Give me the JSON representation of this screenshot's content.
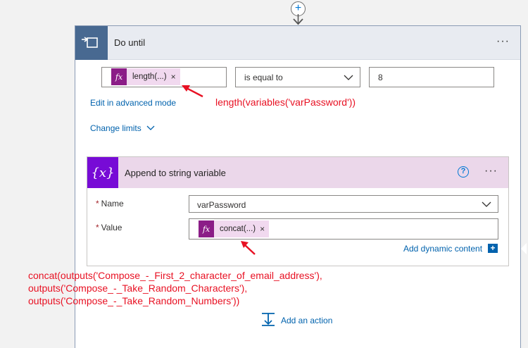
{
  "do_until": {
    "title": "Do until",
    "condition": {
      "left_token": "length(...)",
      "left_token_close": "×",
      "operator": "is equal to",
      "right_value": "8"
    },
    "edit_advanced_label": "Edit in advanced mode",
    "change_limits_label": "Change limits"
  },
  "append_action": {
    "icon_text": "{x}",
    "title": "Append to string variable",
    "name_label": "Name",
    "name_value": "varPassword",
    "value_label": "Value",
    "value_token": "concat(...)",
    "value_token_close": "×",
    "add_dynamic_label": "Add dynamic content",
    "add_dynamic_plus": "+"
  },
  "required_marker": "*",
  "fx_label": "fx",
  "ellipsis": "···",
  "help_glyph": "?",
  "connector_plus": "+",
  "add_action_label": "Add an action",
  "annotations": {
    "length_expr": "length(variables('varPassword'))",
    "concat_line1": "concat(outputs('Compose_-_First_2_character_of_email_address'),",
    "concat_line2": "outputs('Compose_-_Take_Random_Characters'),",
    "concat_line3": "outputs('Compose_-_Take_Random_Numbers'))"
  },
  "colors": {
    "do_until_header": "#e8ebf1",
    "do_until_icon": "#486991",
    "append_header": "#ebd7ea",
    "append_icon": "#770bd6",
    "fx_token": "#8b1d87",
    "link": "#0062ad",
    "annotation_red": "#e81123"
  }
}
